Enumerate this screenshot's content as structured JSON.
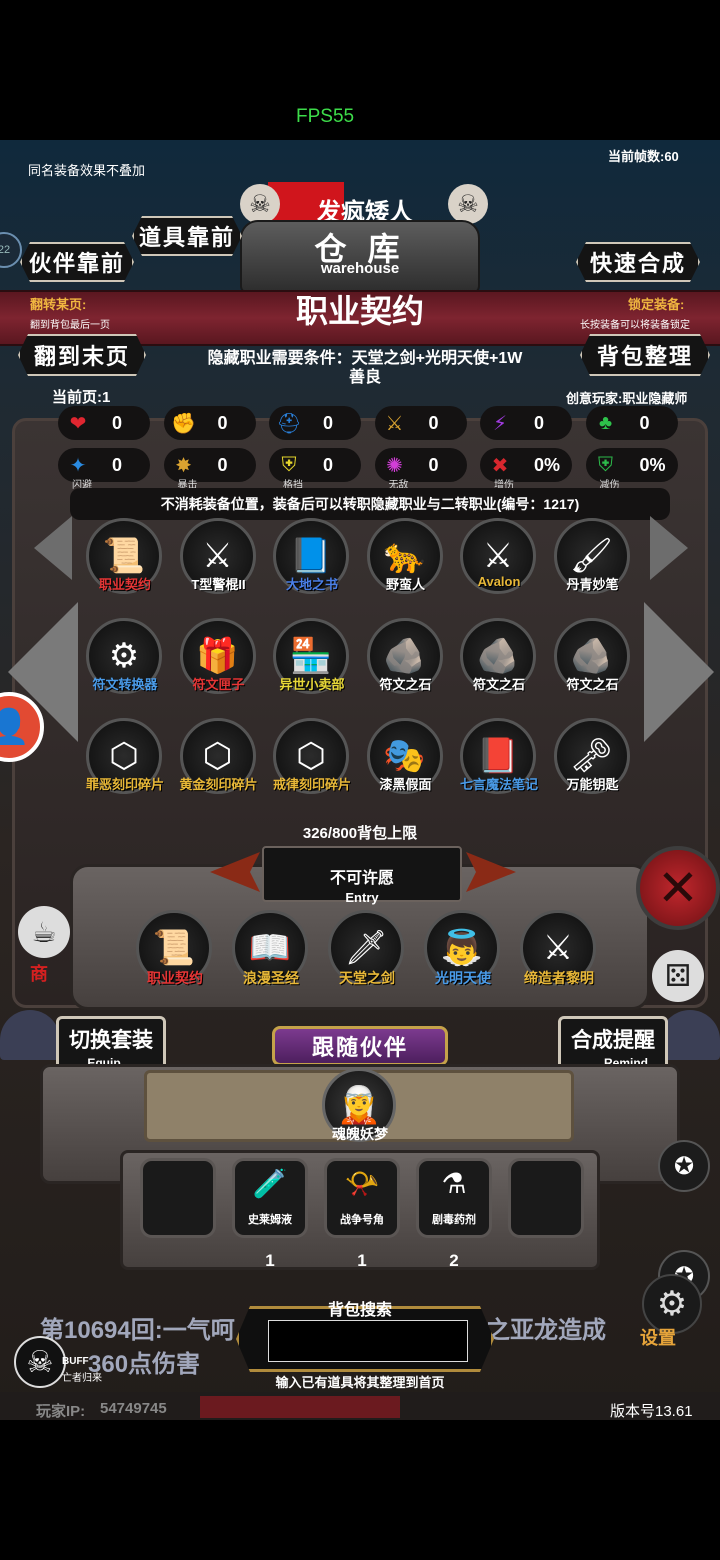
{
  "fps": "FPS55",
  "header": {
    "effect_note": "同名装备效果不叠加",
    "frame_count": "当前帧数:60",
    "npc_name": "发疯矮人",
    "warehouse_title": "仓 库",
    "warehouse_sub": "warehouse",
    "buttons": {
      "companion_front": "伙伴靠前",
      "item_front": "道具靠前",
      "quick_craft": "快速合成",
      "to_last_page": "翻到末页",
      "sort_bag": "背包整理"
    },
    "flip_title": "翻转某页:",
    "flip_desc": "翻到背包最后一页",
    "lock_title": "锁定装备:",
    "lock_desc": "长按装备可以将装备锁定"
  },
  "contract": {
    "title": "职业契约",
    "condition": "隐藏职业需要条件：天堂之剑+光明天使+1W",
    "condition_line2": "善良",
    "current_page": "当前页:1",
    "creator": "创意玩家:职业隐藏师",
    "description": "不消耗装备位置，装备后可以转职隐藏职业与二转职业(编号：1217)"
  },
  "stats": [
    {
      "icon": "heart-icon",
      "glyph": "❤",
      "color": "#e02630",
      "value": "0",
      "sub": ""
    },
    {
      "icon": "strength-icon",
      "glyph": "✊",
      "color": "#e9b526",
      "value": "0",
      "sub": ""
    },
    {
      "icon": "helmet-icon",
      "glyph": "⛑",
      "color": "#2a7fd8",
      "value": "0",
      "sub": ""
    },
    {
      "icon": "sword-icon",
      "glyph": "⚔",
      "color": "#d9a230",
      "value": "0",
      "sub": ""
    },
    {
      "icon": "lightning-icon",
      "glyph": "⚡",
      "color": "#a13be0",
      "value": "0",
      "sub": ""
    },
    {
      "icon": "clover-icon",
      "glyph": "♣",
      "color": "#2ec24b",
      "value": "0",
      "sub": ""
    },
    {
      "icon": "dodge-icon",
      "glyph": "✦",
      "color": "#2a8ae0",
      "value": "0",
      "sub": "闪避"
    },
    {
      "icon": "crit-icon",
      "glyph": "✸",
      "color": "#d9a230",
      "value": "0",
      "sub": "暴击"
    },
    {
      "icon": "block-icon",
      "glyph": "⛨",
      "color": "#e5d52c",
      "value": "0",
      "sub": "格挡"
    },
    {
      "icon": "invincible-icon",
      "glyph": "✺",
      "color": "#d23ed8",
      "value": "0",
      "sub": "无敌"
    },
    {
      "icon": "damage-up-icon",
      "glyph": "✖",
      "color": "#d8272e",
      "value": "0%",
      "sub": "增伤"
    },
    {
      "icon": "damage-down-icon",
      "glyph": "⛨",
      "color": "#2dbb4b",
      "value": "0%",
      "sub": "减伤"
    }
  ],
  "inventory": [
    {
      "name": "职业契约",
      "glyph": "📜",
      "color": "#e53535"
    },
    {
      "name": "T型警棍II",
      "glyph": "⚔",
      "color": "#ffffff"
    },
    {
      "name": "大地之书",
      "glyph": "📘",
      "color": "#4a7fe8"
    },
    {
      "name": "野蛮人",
      "glyph": "🐆",
      "color": "#ffffff"
    },
    {
      "name": "Avalon",
      "glyph": "⚔",
      "color": "#e8b838"
    },
    {
      "name": "丹青妙笔",
      "glyph": "🖌",
      "color": "#ffffff"
    },
    {
      "name": "符文转换器",
      "glyph": "⚙",
      "color": "#4a9be8"
    },
    {
      "name": "符文匣子",
      "glyph": "🎁",
      "color": "#e53535"
    },
    {
      "name": "异世小卖部",
      "glyph": "🏪",
      "color": "#e8d838"
    },
    {
      "name": "符文之石",
      "glyph": "🪨",
      "color": "#ffffff"
    },
    {
      "name": "符文之石",
      "glyph": "🪨",
      "color": "#ffffff"
    },
    {
      "name": "符文之石",
      "glyph": "🪨",
      "color": "#ffffff"
    },
    {
      "name": "罪恶刻印碎片",
      "glyph": "⬡",
      "color": "#e8b838"
    },
    {
      "name": "黄金刻印碎片",
      "glyph": "⬡",
      "color": "#e8b838"
    },
    {
      "name": "戒律刻印碎片",
      "glyph": "⬡",
      "color": "#e8b838"
    },
    {
      "name": "漆黑假面",
      "glyph": "🎭",
      "color": "#ffffff"
    },
    {
      "name": "七言魔法笔记",
      "glyph": "📕",
      "color": "#4a9be8"
    },
    {
      "name": "万能钥匙",
      "glyph": "🗝",
      "color": "#ffffff"
    }
  ],
  "bag_capacity": "326/800背包上限",
  "wish": {
    "title": "不可许愿",
    "sub": "Entry"
  },
  "equipped": [
    {
      "name": "职业契约",
      "glyph": "📜",
      "color": "#e53535"
    },
    {
      "name": "浪漫圣经",
      "glyph": "📖",
      "color": "#e8b838"
    },
    {
      "name": "天堂之剑",
      "glyph": "🗡",
      "color": "#e8b838"
    },
    {
      "name": "光明天使",
      "glyph": "👼",
      "color": "#4a9be8"
    },
    {
      "name": "缔造者黎明",
      "glyph": "⚔",
      "color": "#e8b838"
    }
  ],
  "shop_label": "商",
  "switch_set": {
    "title": "切换套装",
    "sub": "Equip"
  },
  "craft_remind": {
    "title": "合成提醒",
    "sub": "Remind"
  },
  "follow_companion": "跟随伙伴",
  "companion": {
    "name": "魂魄妖梦"
  },
  "consumables": [
    {
      "name": "",
      "count": ""
    },
    {
      "name": "史莱姆液",
      "glyph": "🧪",
      "count": "1"
    },
    {
      "name": "战争号角",
      "glyph": "📯",
      "count": "1"
    },
    {
      "name": "剧毒药剂",
      "glyph": "⚗",
      "count": "2"
    },
    {
      "name": "",
      "count": ""
    }
  ],
  "battle_log": {
    "line1": "第10694回:一气呵",
    "line1_tail": "之亚龙造成",
    "line2": "360点伤害"
  },
  "search": {
    "title": "背包搜索",
    "hint": "输入已有道具将其整理到首页",
    "value": ""
  },
  "buff": {
    "label": "BUFF",
    "name": "亡者归来"
  },
  "settings_label": "设置",
  "player_ip_label": "玩家IP:",
  "player_ip": "54749745",
  "version": "版本号13.61",
  "side_badge": "22"
}
